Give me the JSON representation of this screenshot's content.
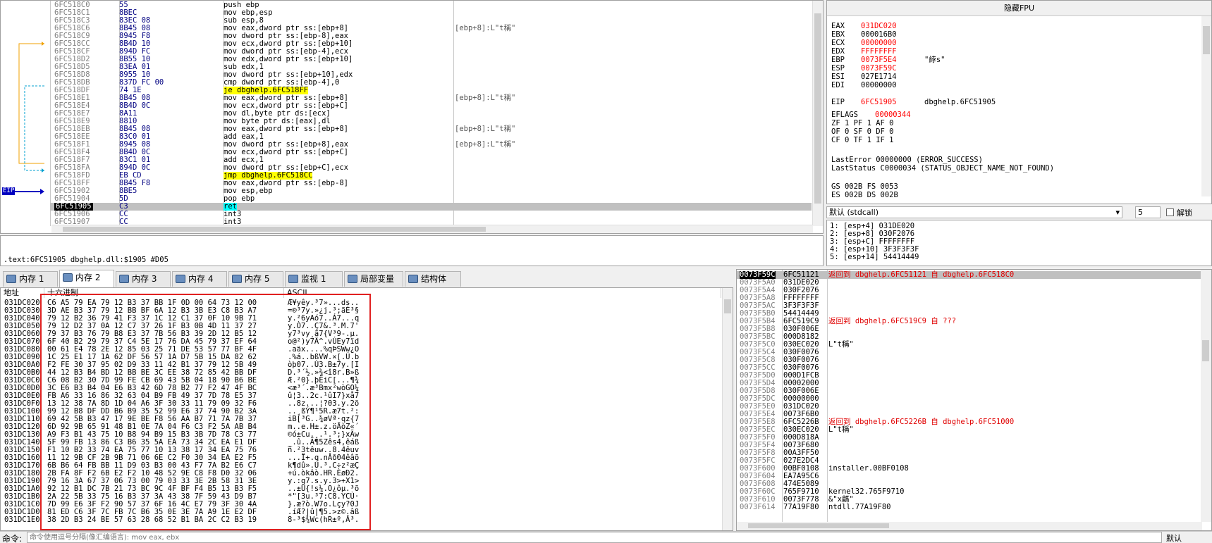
{
  "disasm": {
    "rows": [
      {
        "addr": "6FC518C0",
        "bytes": "55",
        "ins": "push ebp",
        "cmt": ""
      },
      {
        "addr": "6FC518C1",
        "bytes": "8BEC",
        "ins": "mov ebp,esp",
        "cmt": ""
      },
      {
        "addr": "6FC518C3",
        "bytes": "83EC 08",
        "ins": "sub esp,8",
        "cmt": ""
      },
      {
        "addr": "6FC518C6",
        "bytes": "8B45 08",
        "ins": "mov eax,dword ptr ss:[ebp+8]",
        "cmt": "[ebp+8]:L\"t稱\""
      },
      {
        "addr": "6FC518C9",
        "bytes": "8945 F8",
        "ins": "mov dword ptr ss:[ebp-8],eax",
        "cmt": ""
      },
      {
        "addr": "6FC518CC",
        "bytes": "8B4D 10",
        "ins": "mov ecx,dword ptr ss:[ebp+10]",
        "cmt": ""
      },
      {
        "addr": "6FC518CF",
        "bytes": "894D FC",
        "ins": "mov dword ptr ss:[ebp-4],ecx",
        "cmt": ""
      },
      {
        "addr": "6FC518D2",
        "bytes": "8B55 10",
        "ins": "mov edx,dword ptr ss:[ebp+10]",
        "cmt": ""
      },
      {
        "addr": "6FC518D5",
        "bytes": "83EA 01",
        "ins": "sub edx,1",
        "cmt": ""
      },
      {
        "addr": "6FC518D8",
        "bytes": "8955 10",
        "ins": "mov dword ptr ss:[ebp+10],edx",
        "cmt": ""
      },
      {
        "addr": "6FC518DB",
        "bytes": "837D FC 00",
        "ins": "cmp dword ptr ss:[ebp-4],0",
        "cmt": ""
      },
      {
        "addr": "6FC518DF",
        "bytes": "74 1E",
        "ins": "je dbghelp.6FC518FF",
        "cmt": "",
        "cls": "jmp"
      },
      {
        "addr": "6FC518E1",
        "bytes": "8B45 08",
        "ins": "mov eax,dword ptr ss:[ebp+8]",
        "cmt": "[ebp+8]:L\"t稱\""
      },
      {
        "addr": "6FC518E4",
        "bytes": "8B4D 0C",
        "ins": "mov ecx,dword ptr ss:[ebp+C]",
        "cmt": ""
      },
      {
        "addr": "6FC518E7",
        "bytes": "8A11",
        "ins": "mov dl,byte ptr ds:[ecx]",
        "cmt": ""
      },
      {
        "addr": "6FC518E9",
        "bytes": "8810",
        "ins": "mov byte ptr ds:[eax],dl",
        "cmt": ""
      },
      {
        "addr": "6FC518EB",
        "bytes": "8B45 08",
        "ins": "mov eax,dword ptr ss:[ebp+8]",
        "cmt": "[ebp+8]:L\"t稱\""
      },
      {
        "addr": "6FC518EE",
        "bytes": "83C0 01",
        "ins": "add eax,1",
        "cmt": ""
      },
      {
        "addr": "6FC518F1",
        "bytes": "8945 08",
        "ins": "mov dword ptr ss:[ebp+8],eax",
        "cmt": "[ebp+8]:L\"t稱\""
      },
      {
        "addr": "6FC518F4",
        "bytes": "8B4D 0C",
        "ins": "mov ecx,dword ptr ss:[ebp+C]",
        "cmt": ""
      },
      {
        "addr": "6FC518F7",
        "bytes": "83C1 01",
        "ins": "add ecx,1",
        "cmt": ""
      },
      {
        "addr": "6FC518FA",
        "bytes": "894D 0C",
        "ins": "mov dword ptr ss:[ebp+C],ecx",
        "cmt": ""
      },
      {
        "addr": "6FC518FD",
        "bytes": "EB CD",
        "ins": "jmp dbghelp.6FC518CC",
        "cmt": "",
        "cls": "jmp"
      },
      {
        "addr": "6FC518FF",
        "bytes": "8B45 F8",
        "ins": "mov eax,dword ptr ss:[ebp-8]",
        "cmt": ""
      },
      {
        "addr": "6FC51902",
        "bytes": "8BE5",
        "ins": "mov esp,ebp",
        "cmt": ""
      },
      {
        "addr": "6FC51904",
        "bytes": "5D",
        "ins": "pop ebp",
        "cmt": ""
      },
      {
        "addr": "6FC51905",
        "bytes": "C3",
        "ins": "ret",
        "cmt": "",
        "cls": "eiprow ret hlrow"
      },
      {
        "addr": "6FC51906",
        "bytes": "CC",
        "ins": "int3",
        "cmt": ""
      },
      {
        "addr": "6FC51907",
        "bytes": "CC",
        "ins": "int3",
        "cmt": ""
      }
    ],
    "eip_label": "EIP"
  },
  "infobar": {
    "text": ".text:6FC51905 dbghelp.dll:$1905 #D05"
  },
  "regs": {
    "title": "隐藏FPU",
    "lines": [
      {
        "n": "EAX",
        "v": "031DC020",
        "c": "",
        "red": true
      },
      {
        "n": "EBX",
        "v": "000016B0",
        "c": "",
        "red": false
      },
      {
        "n": "ECX",
        "v": "00000000",
        "c": "",
        "red": true
      },
      {
        "n": "EDX",
        "v": "FFFFFFFF",
        "c": "",
        "red": true
      },
      {
        "n": "EBP",
        "v": "0073F5E4",
        "c": "\"綍s\"",
        "red": true
      },
      {
        "n": "ESP",
        "v": "0073F59C",
        "c": "",
        "red": true
      },
      {
        "n": "ESI",
        "v": "027E1714",
        "c": "",
        "red": false
      },
      {
        "n": "EDI",
        "v": "00000000",
        "c": "",
        "red": false
      },
      {
        "n": "EIP",
        "v": "6FC51905",
        "c": "dbghelp.6FC51905",
        "red": true
      },
      {
        "n": "EFLAGS",
        "v": "00000344",
        "c": "",
        "red": true
      }
    ],
    "flags1": "ZF 1  PF 1  AF 0",
    "flags2": "OF 0  SF 0  DF 0",
    "flags3": "CF 0  TF 1  IF 1",
    "lasterror": "LastError  00000000 (ERROR_SUCCESS)",
    "laststatus": "LastStatus C0000034 (STATUS_OBJECT_NAME_NOT_FOUND)",
    "seg1": "GS 002B  FS 0053",
    "seg2": "ES 002B  DS 002B"
  },
  "callconv": {
    "value": "默认 (stdcall)",
    "count": "5",
    "unlock": "解锁"
  },
  "stackargs": [
    "1: [esp+4] 031DE020",
    "2: [esp+8] 030F2076",
    "3: [esp+C] FFFFFFFF",
    "4: [esp+10] 3F3F3F3F",
    "5: [esp+14] 54414449"
  ],
  "tabs": [
    {
      "label": "内存 1"
    },
    {
      "label": "内存 2",
      "active": true
    },
    {
      "label": "内存 3"
    },
    {
      "label": "内存 4"
    },
    {
      "label": "内存 5"
    },
    {
      "label": "监视 1"
    },
    {
      "label": "局部变量"
    },
    {
      "label": "结构体"
    }
  ],
  "dump": {
    "headers": {
      "addr": "地址",
      "hex": "十六进制",
      "ascii": "ASCII"
    },
    "rows": [
      {
        "a": "031DC020",
        "h": "C6 A5 79 EA 79 12 B3 37 BB 1F 0D 00 64 73 12 00",
        "c": "Æ¥yêy.³7»...ds.."
      },
      {
        "a": "031DC030",
        "h": "3D AE B3 37 79 12 BB BF 6A 12 B3 3B E3 C8 B3 A7",
        "c": "=®³7y.»¿j.³;ãÈ³§"
      },
      {
        "a": "031DC040",
        "h": "79 12 B2 36 79 41 F3 37 1C 12 C1 37 0F 10 9B 71",
        "c": "y.²6yAó7..Á7...q"
      },
      {
        "a": "031DC050",
        "h": "79 12 D2 37 0A 12 C7 37 26 1F B3 0B 4D 11 37 27",
        "c": "y.Ò7..Ç7&.³.M.7'"
      },
      {
        "a": "031DC060",
        "h": "79 37 B3 76 79 B8 E3 37 7B 56 B3 39 2D 12 B5 12",
        "c": "y7³vy¸ã7{V³9-.µ."
      },
      {
        "a": "031DC070",
        "h": "6F 40 B2 29 79 37 C4 5E 17 76 DA 45 79 37 EF 64",
        "c": "o@²)y7Ä^.vÚEy7ïd"
      },
      {
        "a": "031DC080",
        "h": "00 61 E4 78 2E 12 85 03 25 71 DE 53 57 77 BF 4F",
        "c": ".aäx....%qÞSWw¿O"
      },
      {
        "a": "031DC090",
        "h": "1C 25 E1 17 1A 62 DF 56 57 1A D7 5B 15 DA 82 62",
        "c": ".%á..bßVW.×[.Ú.b"
      },
      {
        "a": "031DC0A0",
        "h": "F2 FE 30 37 95 02 D9 33 11 42 B1 37 79 12 5B 49",
        "c": "òþ07..Ù3.B±7y.[I"
      },
      {
        "a": "031DC0B0",
        "h": "44 12 B3 B4 BD 12 BB BE 3C EE 38 72 85 42 BB DF",
        "c": "D.³´½.»¾<î8r.B»ß"
      },
      {
        "a": "031DC0C0",
        "h": "C6 08 B2 30 7D 99 FE CB 69 43 5B 04 18 90 B6 BE",
        "c": "Æ.²0}.þËiC[...¶¾"
      },
      {
        "a": "031DC0D0",
        "h": "3C E6 B3 B4 04 E6 B3 42 6D 78 B2 77 F2 47 4F BC",
        "c": "<æ³´.æ³Bmx²wòGO¼"
      },
      {
        "a": "031DC0E0",
        "h": "FB A6 33 16 86 32 63 04 B9 FB 49 37 7D 78 E5 37",
        "c": "û¦3..2c.¹ûI7}xå7"
      },
      {
        "a": "031DC0F0",
        "h": "13 12 38 7A 8D 1D 04 A6 3F 30 33 11 79 09 32 F6",
        "c": "..8z...¦?03.y.2ö"
      },
      {
        "a": "031DC100",
        "h": "99 12 B8 DF DD B6 B9 35 52 99 E6 37 74 90 B2 3A",
        "c": "..¸ßÝ¶¹5R.æ7t.²:"
      },
      {
        "a": "031DC110",
        "h": "69 42 5B B3 47 17 9E BE F8 56 AA B7 71 7A 7B 37",
        "c": "iB[³G..¾øVª·qz{7"
      },
      {
        "a": "031DC120",
        "h": "6D 92 9B 65 91 48 B1 0E 7A 04 F6 C3 F2 5A AB B4",
        "c": "m..e.H±.z.öÃòZ«´"
      },
      {
        "a": "031DC130",
        "h": "A9 F3 B1 43 75 10 B8 94 B9 15 B3 3B 7D 78 C3 77",
        "c": "©ó±Cu.¸.¹.³;}xÃw"
      },
      {
        "a": "031DC140",
        "h": "5F 99 FB 13 86 C3 B6 35 5A EA 73 34 2C EA E1 DF",
        "c": "_.û..Ã¶5Zês4,êáß"
      },
      {
        "a": "031DC150",
        "h": "F1 10 B2 33 74 EA 75 77 10 13 38 17 34 EA 75 76",
        "c": "ñ.²3têuw..8.4êuv"
      },
      {
        "a": "031DC160",
        "h": "11 12 9B CF 2B 9B 71 06 6E C2 F0 30 34 EA E2 F5",
        "c": "...Ï+.q.nÂð04êâõ"
      },
      {
        "a": "031DC170",
        "h": "6B B6 64 FB BB 11 D9 03 B3 00 43 F7 7A B2 E6 C7",
        "c": "k¶dû».Ù.³.C÷z²æÇ"
      },
      {
        "a": "031DC180",
        "h": "2B FA 8F F2 6B E2 F2 10 48 52 9E C8 F8 D0 32 06",
        "c": "+ú.òkâò.HR.ÈøÐ2."
      },
      {
        "a": "031DC190",
        "h": "79 16 3A 67 37 06 73 00 79 03 33 3E 2B 58 31 3E",
        "c": "y.:g7.s.y.3>+X1>"
      },
      {
        "a": "031DC1A0",
        "h": "92 12 B1 DC 7B 21 73 BC 9C 4F BF F4 B5 13 B3 F5",
        "c": "..±Ü{!s¼.O¿ôµ.³õ"
      },
      {
        "a": "031DC1B0",
        "h": "2A 22 5B 33 75 16 B3 37 3A 43 38 7F 59 43 D9 B7",
        "c": "*\"[3u.³7:C8.YCÙ·"
      },
      {
        "a": "031DC1C0",
        "h": "7D 99 E6 3F F2 90 57 37 6F 16 4C E7 79 3F 30 4A",
        "c": "}.æ?ò.W7o.Lçy?0J"
      },
      {
        "a": "031DC1D0",
        "h": "81 ED C6 3F 7C FB 7C B6 35 0E 3E 7A A9 1E E2 DF",
        "c": ".íÆ?|û|¶5.>z©.âß"
      },
      {
        "a": "031DC1E0",
        "h": "38 2D B3 24 BE 57 63 28 68 52 B1 BA 2C C2 B3 19",
        "c": "8-³$¾Wc(hR±º,Â³."
      }
    ]
  },
  "stack": {
    "rows": [
      {
        "a": "0073F59C",
        "v": "6FC51121",
        "c": "返回到 dbghelp.6FC51121 自 dbghelp.6FC518C0",
        "red": true,
        "cur": true
      },
      {
        "a": "0073F5A0",
        "v": "031DE020",
        "c": ""
      },
      {
        "a": "0073F5A4",
        "v": "030F2076",
        "c": ""
      },
      {
        "a": "0073F5A8",
        "v": "FFFFFFFF",
        "c": ""
      },
      {
        "a": "0073F5AC",
        "v": "3F3F3F3F",
        "c": ""
      },
      {
        "a": "0073F5B0",
        "v": "54414449",
        "c": ""
      },
      {
        "a": "0073F5B4",
        "v": "6FC519C9",
        "c": "返回到 dbghelp.6FC519C9 自 ???",
        "red": true
      },
      {
        "a": "0073F5B8",
        "v": "030F006E",
        "c": ""
      },
      {
        "a": "0073F5BC",
        "v": "000D8182",
        "c": ""
      },
      {
        "a": "0073F5C0",
        "v": "030EC020",
        "c": "L\"t稱\""
      },
      {
        "a": "0073F5C4",
        "v": "030F0076",
        "c": ""
      },
      {
        "a": "0073F5C8",
        "v": "030F0076",
        "c": ""
      },
      {
        "a": "0073F5CC",
        "v": "030F0076",
        "c": ""
      },
      {
        "a": "0073F5D0",
        "v": "000D1FCB",
        "c": ""
      },
      {
        "a": "0073F5D4",
        "v": "00002000",
        "c": ""
      },
      {
        "a": "0073F5D8",
        "v": "030F006E",
        "c": ""
      },
      {
        "a": "0073F5DC",
        "v": "00000000",
        "c": ""
      },
      {
        "a": "0073F5E0",
        "v": "031DC020",
        "c": ""
      },
      {
        "a": "0073F5E4",
        "v": "0073F6B0",
        "c": ""
      },
      {
        "a": "0073F5E8",
        "v": "6FC5226B",
        "c": "返回到 dbghelp.6FC5226B 自 dbghelp.6FC51000",
        "red": true
      },
      {
        "a": "0073F5EC",
        "v": "030EC020",
        "c": "L\"t稱\""
      },
      {
        "a": "0073F5F0",
        "v": "000D818A",
        "c": ""
      },
      {
        "a": "0073F5F4",
        "v": "0073F680",
        "c": ""
      },
      {
        "a": "0073F5F8",
        "v": "00A3FF50",
        "c": ""
      },
      {
        "a": "0073F5FC",
        "v": "027E2DC4",
        "c": ""
      },
      {
        "a": "0073F600",
        "v": "00BF0108",
        "c": "installer.00BF0108"
      },
      {
        "a": "0073F604",
        "v": "EA7A95C6",
        "c": ""
      },
      {
        "a": "0073F608",
        "v": "474E5089",
        "c": ""
      },
      {
        "a": "0073F60C",
        "v": "765F9710",
        "c": "kernel32.765F9710"
      },
      {
        "a": "0073F610",
        "v": "0073F778",
        "c": "&\"x騗\""
      },
      {
        "a": "0073F614",
        "v": "77A19F80",
        "c": "ntdll.77A19F80"
      }
    ]
  },
  "cmd": {
    "label": "命令:",
    "placeholder": "命令使用逗号分隔(像汇编语言): mov eax, ebx",
    "right": "默认"
  }
}
